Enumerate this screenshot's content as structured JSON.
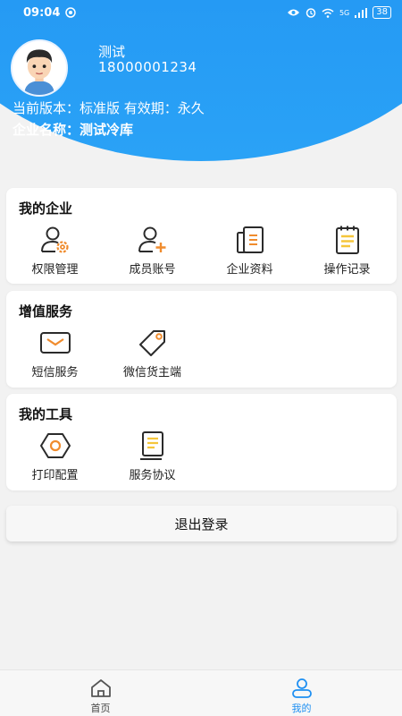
{
  "status_bar": {
    "time": "09:04",
    "signal": "5G",
    "battery": "38"
  },
  "user": {
    "name": "测试",
    "phone": "18000001234"
  },
  "info": {
    "version": "当前版本：标准版 有效期：永久",
    "company": "企业名称：测试冷库"
  },
  "sections": [
    {
      "title": "我的企业",
      "items": [
        {
          "label": "权限管理",
          "icon": "user-gear-icon"
        },
        {
          "label": "成员账号",
          "icon": "user-add-icon"
        },
        {
          "label": "企业资料",
          "icon": "document-icon"
        },
        {
          "label": "操作记录",
          "icon": "notepad-icon"
        }
      ]
    },
    {
      "title": "增值服务",
      "items": [
        {
          "label": "短信服务",
          "icon": "envelope-icon"
        },
        {
          "label": "微信货主端",
          "icon": "tag-icon"
        }
      ]
    },
    {
      "title": "我的工具",
      "items": [
        {
          "label": "打印配置",
          "icon": "nut-icon"
        },
        {
          "label": "服务协议",
          "icon": "file-list-icon"
        }
      ]
    }
  ],
  "logout_label": "退出登录",
  "tabs": [
    {
      "label": "首页",
      "icon": "home-icon"
    },
    {
      "label": "我的",
      "icon": "person-icon"
    }
  ],
  "colors": {
    "primary": "#1e8ff2",
    "accent": "#f08c2e",
    "accent_yellow": "#f5c63b"
  }
}
